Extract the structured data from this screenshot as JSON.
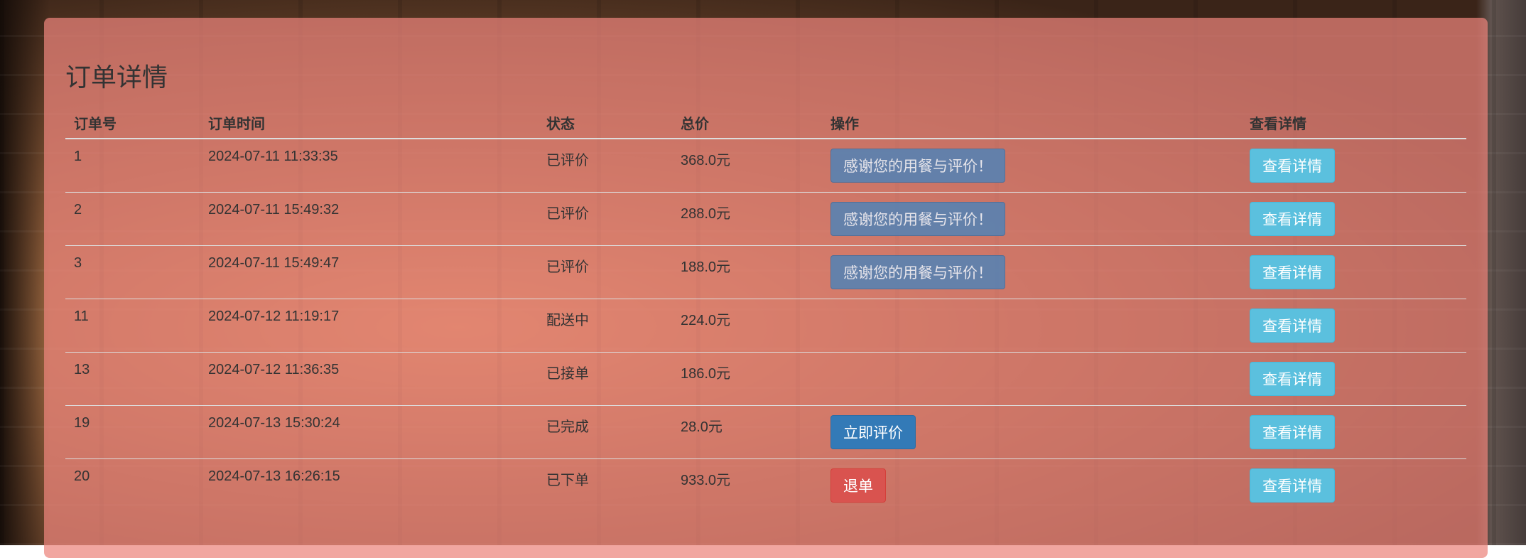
{
  "page": {
    "title": "订单详情"
  },
  "table": {
    "headers": [
      "订单号",
      "订单时间",
      "状态",
      "总价",
      "操作",
      "查看详情"
    ],
    "rows": [
      {
        "id": "1",
        "time": "2024-07-11 11:33:35",
        "status": "已评价",
        "total": "368.0元",
        "action": "感谢您的用餐与评价！",
        "action_type": "thanks",
        "detail": "查看详情"
      },
      {
        "id": "2",
        "time": "2024-07-11 15:49:32",
        "status": "已评价",
        "total": "288.0元",
        "action": "感谢您的用餐与评价！",
        "action_type": "thanks",
        "detail": "查看详情"
      },
      {
        "id": "3",
        "time": "2024-07-11 15:49:47",
        "status": "已评价",
        "total": "188.0元",
        "action": "感谢您的用餐与评价！",
        "action_type": "thanks",
        "detail": "查看详情"
      },
      {
        "id": "11",
        "time": "2024-07-12 11:19:17",
        "status": "配送中",
        "total": "224.0元",
        "action": "",
        "action_type": "none",
        "detail": "查看详情"
      },
      {
        "id": "13",
        "time": "2024-07-12 11:36:35",
        "status": "已接单",
        "total": "186.0元",
        "action": "",
        "action_type": "none",
        "detail": "查看详情"
      },
      {
        "id": "19",
        "time": "2024-07-13 15:30:24",
        "status": "已完成",
        "total": "28.0元",
        "action": "立即评价",
        "action_type": "review",
        "detail": "查看详情"
      },
      {
        "id": "20",
        "time": "2024-07-13 16:26:15",
        "status": "已下单",
        "total": "933.0元",
        "action": "退单",
        "action_type": "refund",
        "detail": "查看详情"
      }
    ]
  },
  "colors": {
    "panel": "#ec847c",
    "btn_primary": "#337ab7",
    "btn_danger": "#d9534f",
    "btn_info": "#5bc0de"
  }
}
